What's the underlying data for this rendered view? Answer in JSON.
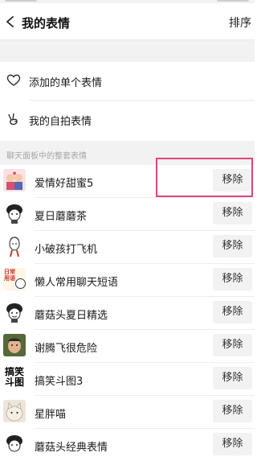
{
  "header": {
    "title": "我的表情",
    "sort_label": "排序"
  },
  "menu": [
    {
      "label": "添加的单个表情",
      "icon": "heart-outline-icon"
    },
    {
      "label": "我的自拍表情",
      "icon": "peace-hand-icon"
    }
  ],
  "section_label": "聊天面板中的整套表情",
  "remove_label": "移除",
  "packs": [
    {
      "name": "爱情好甜蜜5",
      "thumb": "couple-sticker-thumbnail"
    },
    {
      "name": "夏日蘑蘑茶",
      "thumb": "mushroom-head-thumbnail"
    },
    {
      "name": "小破孩打飞机",
      "thumb": "little-boy-thumbnail"
    },
    {
      "name": "懒人常用聊天短语",
      "thumb": "lazy-phrases-thumbnail",
      "thumb_text": "日常\n用语"
    },
    {
      "name": "蘑菇头夏日精选",
      "thumb": "mushroom-head-thumbnail"
    },
    {
      "name": "谢腾飞很危险",
      "thumb": "photo-face-thumbnail"
    },
    {
      "name": "搞笑斗图3",
      "thumb": "text-sticker-thumbnail",
      "thumb_text": "搞笑\n斗图"
    },
    {
      "name": "星胖喵",
      "thumb": "cat-thumbnail"
    },
    {
      "name": "蘑菇头经典表情",
      "thumb": "mushroom-head-thumbnail"
    }
  ],
  "colors": {
    "highlight": "#e0457a",
    "page_bg": "#f2f2f2",
    "button_bg": "#f2f2f2"
  }
}
